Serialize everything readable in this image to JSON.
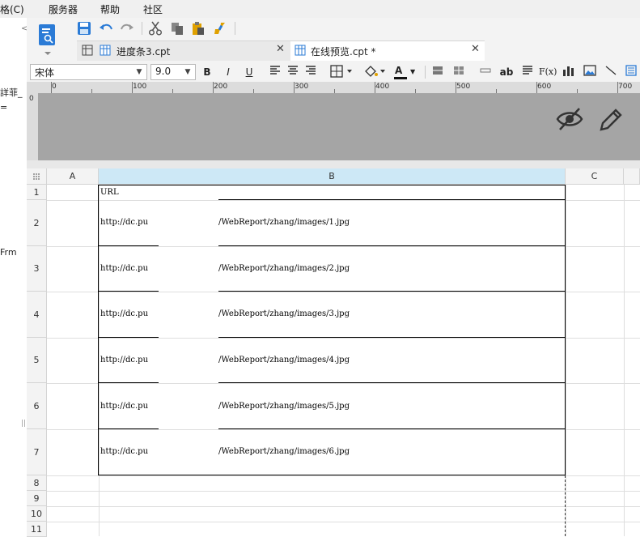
{
  "menubar": {
    "items": [
      "格(C)",
      "服务器",
      "帮助",
      "社区"
    ]
  },
  "left_pane": {
    "fragments": [
      "詳菲_",
      "=",
      "Frm"
    ]
  },
  "tabs": [
    {
      "label": "进度条3.cpt",
      "active": false
    },
    {
      "label": "在线预览.cpt *",
      "active": true
    }
  ],
  "format_bar": {
    "font_family": "宋体",
    "font_size": "9.0",
    "bold_label": "B",
    "italic_label": "I",
    "underline_label": "U",
    "font_color_label": "A",
    "text_tool_label": "ab",
    "formula_label": "F(x)"
  },
  "ruler": {
    "labels": [
      "0",
      "100",
      "200",
      "300",
      "400",
      "500",
      "600",
      "700"
    ]
  },
  "grid": {
    "columns": [
      "A",
      "B",
      "C"
    ],
    "rows": [
      "1",
      "2",
      "3",
      "4",
      "5",
      "6",
      "7",
      "8",
      "9",
      "10",
      "11"
    ],
    "header_cell": "URL",
    "url_prefix": "http://dc.pu",
    "url_suffixes": [
      "/WebReport/zhang/images/1.jpg",
      "/WebReport/zhang/images/2.jpg",
      "/WebReport/zhang/images/3.jpg",
      "/WebReport/zhang/images/4.jpg",
      "/WebReport/zhang/images/5.jpg",
      "/WebReport/zhang/images/6.jpg"
    ]
  },
  "icons": [
    "template-icon",
    "save-icon",
    "undo-icon",
    "redo-icon",
    "cut-icon",
    "copy-icon",
    "paste-icon",
    "format-painter-icon",
    "grid-tab-icon",
    "border-icon",
    "fill-color-icon",
    "hide-preview-icon",
    "edit-icon",
    "chart-icon",
    "image-icon"
  ],
  "colors": {
    "accent": "#2b7bd6",
    "selected_col": "#cde8f6",
    "gray_area": "#a5a5a5"
  }
}
